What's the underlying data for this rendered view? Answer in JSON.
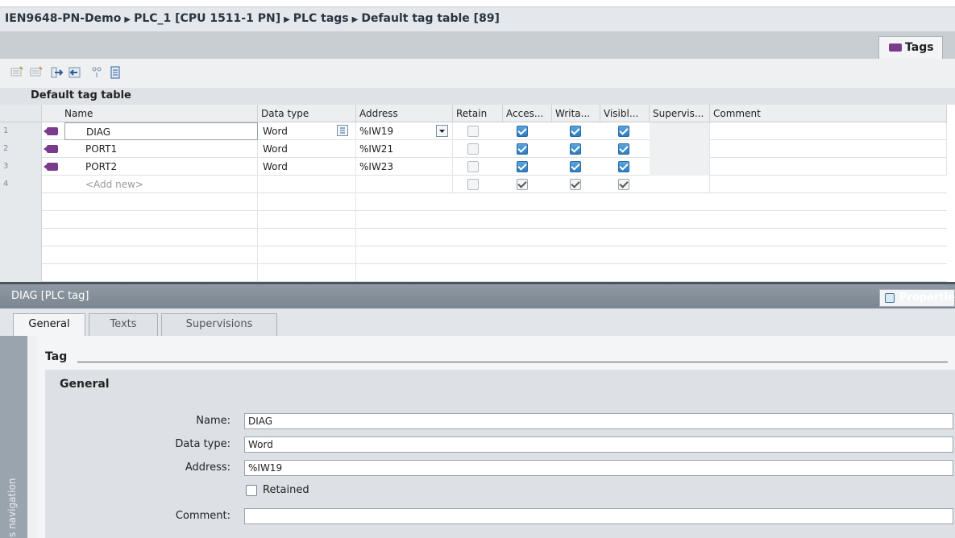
{
  "breadcrumb": [
    "IEN9648-PN-Demo",
    "PLC_1 [CPU 1511-1 PN]",
    "PLC tags",
    "Default tag table [89]"
  ],
  "tags_tab": "Tags",
  "table": {
    "title": "Default tag table",
    "columns": [
      "Name",
      "Data type",
      "Address",
      "Retain",
      "Acces...",
      "Writa...",
      "Visibl...",
      "Supervis...",
      "Comment"
    ],
    "rows": [
      {
        "num": "1",
        "name": "DIAG",
        "type": "Word",
        "address": "%IW19",
        "retain": false,
        "access": true,
        "write": true,
        "visible": true
      },
      {
        "num": "2",
        "name": "PORT1",
        "type": "Word",
        "address": "%IW21",
        "retain": false,
        "access": true,
        "write": true,
        "visible": true
      },
      {
        "num": "3",
        "name": "PORT2",
        "type": "Word",
        "address": "%IW23",
        "retain": false,
        "access": true,
        "write": true,
        "visible": true
      },
      {
        "num": "4",
        "name": "<Add new>",
        "type": "",
        "address": "",
        "retain": false,
        "access": true,
        "write": true,
        "visible": true
      }
    ]
  },
  "properties": {
    "title": "DIAG [PLC tag]",
    "button": "Propertie",
    "tabs": [
      "General",
      "Texts",
      "Supervisions"
    ],
    "section": "Tag",
    "group": "General",
    "fields": {
      "name_label": "Name:",
      "name_value": "DIAG",
      "type_label": "Data type:",
      "type_value": "Word",
      "address_label": "Address:",
      "address_value": "%IW19",
      "retained_label": "Retained",
      "comment_label": "Comment:",
      "comment_value": ""
    },
    "sidebar_label": "s navigation"
  },
  "colors": {
    "accent": "#2d7cc0",
    "tag_icon": "#7a3b8c",
    "header_bar": "#7b8691"
  }
}
